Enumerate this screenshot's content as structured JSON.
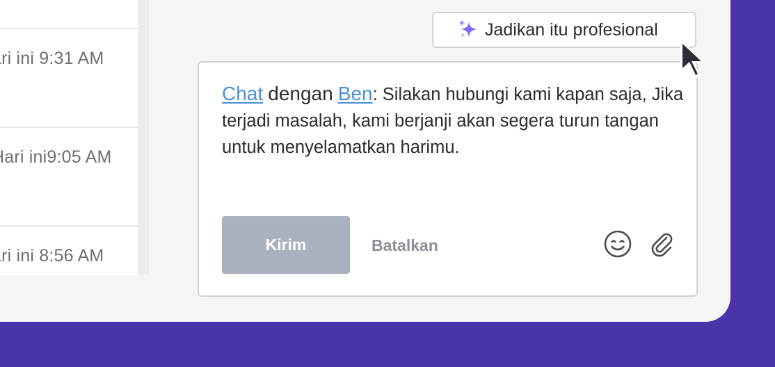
{
  "conversation_list": {
    "items": [
      {
        "time": "ari ini 9:31 AM"
      },
      {
        "time": "Hari ini9:05 AM"
      },
      {
        "time": "ari ini 8:56 AM"
      }
    ]
  },
  "toolbar": {
    "make_professional_label": "Jadikan itu profesional",
    "sparkle_icon": "sparkle-icon"
  },
  "composer": {
    "link_chat": "Chat",
    "word_with": "dengan",
    "link_agent": "Ben",
    "colon": ":",
    "message_text": " Silakan hubungi kami kapan saja, Jika terjadi masalah, kami berjanji akan segera turun tangan untuk menyelamatkan harimu.",
    "send_label": "Kirim",
    "cancel_label": "Batalkan",
    "emoji_icon": "emoji-icon",
    "attach_icon": "paperclip-icon"
  },
  "colors": {
    "brand_purple": "#4b33a8",
    "link_blue": "#4a8fd8",
    "send_disabled": "#aab0bd",
    "sparkle": "#7b6cf0"
  }
}
